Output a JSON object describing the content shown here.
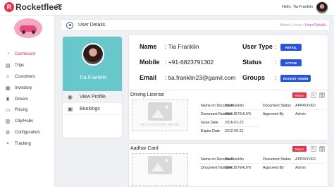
{
  "app": {
    "name": "Rocketfleet",
    "logo_letter": "R"
  },
  "topbar": {
    "greeting": "Hello, Tia Franklin"
  },
  "sidebar": {
    "items": [
      {
        "label": "Dashboard",
        "icon": "dashboard-icon",
        "glyph": "◔",
        "active": true
      },
      {
        "label": "Trips",
        "icon": "trips-icon",
        "glyph": "▤"
      },
      {
        "label": "Customers",
        "icon": "customers-icon",
        "glyph": "☺"
      },
      {
        "label": "Investory",
        "icon": "inventory-icon",
        "glyph": "▦"
      },
      {
        "label": "Drivers",
        "icon": "drivers-icon",
        "glyph": "♜"
      },
      {
        "label": "Pricing",
        "icon": "pricing-icon",
        "glyph": "▭"
      },
      {
        "label": "City/Hubs",
        "icon": "city-icon",
        "glyph": "▥"
      },
      {
        "label": "Configuration",
        "icon": "configuration-icon",
        "glyph": "⚙"
      },
      {
        "label": "Tracking",
        "icon": "tracking-icon",
        "glyph": "⌖"
      }
    ]
  },
  "page": {
    "title": "User Details",
    "breadcrumb": {
      "parent": "Admin Users",
      "sep": "/ ",
      "current": "User Details"
    }
  },
  "profile": {
    "name": "Tia Franklin",
    "menu": [
      {
        "label": "View Profile",
        "icon": "user-icon",
        "glyph": "◉",
        "active": true
      },
      {
        "label": "Bookings",
        "icon": "bookings-icon",
        "glyph": "▣"
      }
    ]
  },
  "user": {
    "name_label": "Name",
    "name_value": ": Tia Franklin",
    "mobile_label": "Mobile",
    "mobile_value": ": +91-6823791302",
    "email_label": "Email",
    "email_value": ": tia.franklin23@gamil.com",
    "type_label": "User Type",
    "type_colon": ":",
    "type_value": "RETAIL",
    "status_label": "Status",
    "status_colon": ":",
    "status_value": "ACTIVE",
    "groups_label": "Groups",
    "groups_colon": ":",
    "groups_value": "ROCKET ADMIN"
  },
  "documents": [
    {
      "title": "Driving License",
      "reject": "Reject",
      "placeholder": "NO CATEGORY IMAGE",
      "fields": [
        {
          "label": "Name on Document",
          "value": "Tia Franklin"
        },
        {
          "label": "Document Number",
          "value": "U9HUB76HUY6"
        },
        {
          "label": "Issue Date",
          "value": "2016-01-23"
        },
        {
          "label": "Expire Date",
          "value": "2012-09-31"
        }
      ],
      "status_label": "Document Status",
      "status_value": "APPROVED",
      "approved_label": "Approved By",
      "approved_value": "Admin"
    },
    {
      "title": "Aadhar Card",
      "reject": "Reject",
      "fields": [
        {
          "label": "Name on Document",
          "value": "Tia Franklin"
        },
        {
          "label": "Document Number",
          "value": "U9HUB76HUY6"
        }
      ],
      "status_label": "Document Status",
      "status_value": "APPROVED",
      "approved_label": "Approved By",
      "approved_value": "Admin"
    }
  ]
}
